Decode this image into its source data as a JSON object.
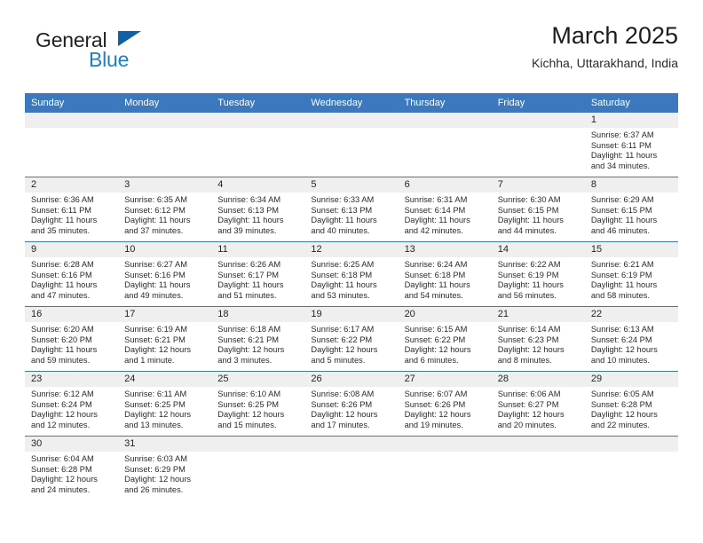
{
  "brand": {
    "name_top": "General",
    "name_bottom": "Blue",
    "accent_dark": "#1060a8",
    "accent_light": "#1a7ec8"
  },
  "header": {
    "title": "March 2025",
    "subtitle": "Kichha, Uttarakhand, India"
  },
  "theme": {
    "header_blue": "#3b78be",
    "band_gray": "#efeff0",
    "text": "#2a2a2a"
  },
  "weekdays": [
    "Sunday",
    "Monday",
    "Tuesday",
    "Wednesday",
    "Thursday",
    "Friday",
    "Saturday"
  ],
  "weeks": [
    [
      {
        "day": "",
        "empty": true
      },
      {
        "day": "",
        "empty": true
      },
      {
        "day": "",
        "empty": true
      },
      {
        "day": "",
        "empty": true
      },
      {
        "day": "",
        "empty": true
      },
      {
        "day": "",
        "empty": true
      },
      {
        "day": "1",
        "sunrise": "Sunrise: 6:37 AM",
        "sunset": "Sunset: 6:11 PM",
        "daylight1": "Daylight: 11 hours",
        "daylight2": "and 34 minutes."
      }
    ],
    [
      {
        "day": "2",
        "sunrise": "Sunrise: 6:36 AM",
        "sunset": "Sunset: 6:11 PM",
        "daylight1": "Daylight: 11 hours",
        "daylight2": "and 35 minutes."
      },
      {
        "day": "3",
        "sunrise": "Sunrise: 6:35 AM",
        "sunset": "Sunset: 6:12 PM",
        "daylight1": "Daylight: 11 hours",
        "daylight2": "and 37 minutes."
      },
      {
        "day": "4",
        "sunrise": "Sunrise: 6:34 AM",
        "sunset": "Sunset: 6:13 PM",
        "daylight1": "Daylight: 11 hours",
        "daylight2": "and 39 minutes."
      },
      {
        "day": "5",
        "sunrise": "Sunrise: 6:33 AM",
        "sunset": "Sunset: 6:13 PM",
        "daylight1": "Daylight: 11 hours",
        "daylight2": "and 40 minutes."
      },
      {
        "day": "6",
        "sunrise": "Sunrise: 6:31 AM",
        "sunset": "Sunset: 6:14 PM",
        "daylight1": "Daylight: 11 hours",
        "daylight2": "and 42 minutes."
      },
      {
        "day": "7",
        "sunrise": "Sunrise: 6:30 AM",
        "sunset": "Sunset: 6:15 PM",
        "daylight1": "Daylight: 11 hours",
        "daylight2": "and 44 minutes."
      },
      {
        "day": "8",
        "sunrise": "Sunrise: 6:29 AM",
        "sunset": "Sunset: 6:15 PM",
        "daylight1": "Daylight: 11 hours",
        "daylight2": "and 46 minutes."
      }
    ],
    [
      {
        "day": "9",
        "sunrise": "Sunrise: 6:28 AM",
        "sunset": "Sunset: 6:16 PM",
        "daylight1": "Daylight: 11 hours",
        "daylight2": "and 47 minutes."
      },
      {
        "day": "10",
        "sunrise": "Sunrise: 6:27 AM",
        "sunset": "Sunset: 6:16 PM",
        "daylight1": "Daylight: 11 hours",
        "daylight2": "and 49 minutes."
      },
      {
        "day": "11",
        "sunrise": "Sunrise: 6:26 AM",
        "sunset": "Sunset: 6:17 PM",
        "daylight1": "Daylight: 11 hours",
        "daylight2": "and 51 minutes."
      },
      {
        "day": "12",
        "sunrise": "Sunrise: 6:25 AM",
        "sunset": "Sunset: 6:18 PM",
        "daylight1": "Daylight: 11 hours",
        "daylight2": "and 53 minutes."
      },
      {
        "day": "13",
        "sunrise": "Sunrise: 6:24 AM",
        "sunset": "Sunset: 6:18 PM",
        "daylight1": "Daylight: 11 hours",
        "daylight2": "and 54 minutes."
      },
      {
        "day": "14",
        "sunrise": "Sunrise: 6:22 AM",
        "sunset": "Sunset: 6:19 PM",
        "daylight1": "Daylight: 11 hours",
        "daylight2": "and 56 minutes."
      },
      {
        "day": "15",
        "sunrise": "Sunrise: 6:21 AM",
        "sunset": "Sunset: 6:19 PM",
        "daylight1": "Daylight: 11 hours",
        "daylight2": "and 58 minutes."
      }
    ],
    [
      {
        "day": "16",
        "sunrise": "Sunrise: 6:20 AM",
        "sunset": "Sunset: 6:20 PM",
        "daylight1": "Daylight: 11 hours",
        "daylight2": "and 59 minutes."
      },
      {
        "day": "17",
        "sunrise": "Sunrise: 6:19 AM",
        "sunset": "Sunset: 6:21 PM",
        "daylight1": "Daylight: 12 hours",
        "daylight2": "and 1 minute."
      },
      {
        "day": "18",
        "sunrise": "Sunrise: 6:18 AM",
        "sunset": "Sunset: 6:21 PM",
        "daylight1": "Daylight: 12 hours",
        "daylight2": "and 3 minutes."
      },
      {
        "day": "19",
        "sunrise": "Sunrise: 6:17 AM",
        "sunset": "Sunset: 6:22 PM",
        "daylight1": "Daylight: 12 hours",
        "daylight2": "and 5 minutes."
      },
      {
        "day": "20",
        "sunrise": "Sunrise: 6:15 AM",
        "sunset": "Sunset: 6:22 PM",
        "daylight1": "Daylight: 12 hours",
        "daylight2": "and 6 minutes."
      },
      {
        "day": "21",
        "sunrise": "Sunrise: 6:14 AM",
        "sunset": "Sunset: 6:23 PM",
        "daylight1": "Daylight: 12 hours",
        "daylight2": "and 8 minutes."
      },
      {
        "day": "22",
        "sunrise": "Sunrise: 6:13 AM",
        "sunset": "Sunset: 6:24 PM",
        "daylight1": "Daylight: 12 hours",
        "daylight2": "and 10 minutes."
      }
    ],
    [
      {
        "day": "23",
        "sunrise": "Sunrise: 6:12 AM",
        "sunset": "Sunset: 6:24 PM",
        "daylight1": "Daylight: 12 hours",
        "daylight2": "and 12 minutes."
      },
      {
        "day": "24",
        "sunrise": "Sunrise: 6:11 AM",
        "sunset": "Sunset: 6:25 PM",
        "daylight1": "Daylight: 12 hours",
        "daylight2": "and 13 minutes."
      },
      {
        "day": "25",
        "sunrise": "Sunrise: 6:10 AM",
        "sunset": "Sunset: 6:25 PM",
        "daylight1": "Daylight: 12 hours",
        "daylight2": "and 15 minutes."
      },
      {
        "day": "26",
        "sunrise": "Sunrise: 6:08 AM",
        "sunset": "Sunset: 6:26 PM",
        "daylight1": "Daylight: 12 hours",
        "daylight2": "and 17 minutes."
      },
      {
        "day": "27",
        "sunrise": "Sunrise: 6:07 AM",
        "sunset": "Sunset: 6:26 PM",
        "daylight1": "Daylight: 12 hours",
        "daylight2": "and 19 minutes."
      },
      {
        "day": "28",
        "sunrise": "Sunrise: 6:06 AM",
        "sunset": "Sunset: 6:27 PM",
        "daylight1": "Daylight: 12 hours",
        "daylight2": "and 20 minutes."
      },
      {
        "day": "29",
        "sunrise": "Sunrise: 6:05 AM",
        "sunset": "Sunset: 6:28 PM",
        "daylight1": "Daylight: 12 hours",
        "daylight2": "and 22 minutes."
      }
    ],
    [
      {
        "day": "30",
        "sunrise": "Sunrise: 6:04 AM",
        "sunset": "Sunset: 6:28 PM",
        "daylight1": "Daylight: 12 hours",
        "daylight2": "and 24 minutes."
      },
      {
        "day": "31",
        "sunrise": "Sunrise: 6:03 AM",
        "sunset": "Sunset: 6:29 PM",
        "daylight1": "Daylight: 12 hours",
        "daylight2": "and 26 minutes."
      },
      {
        "day": "",
        "empty": true
      },
      {
        "day": "",
        "empty": true
      },
      {
        "day": "",
        "empty": true
      },
      {
        "day": "",
        "empty": true
      },
      {
        "day": "",
        "empty": true
      }
    ]
  ]
}
